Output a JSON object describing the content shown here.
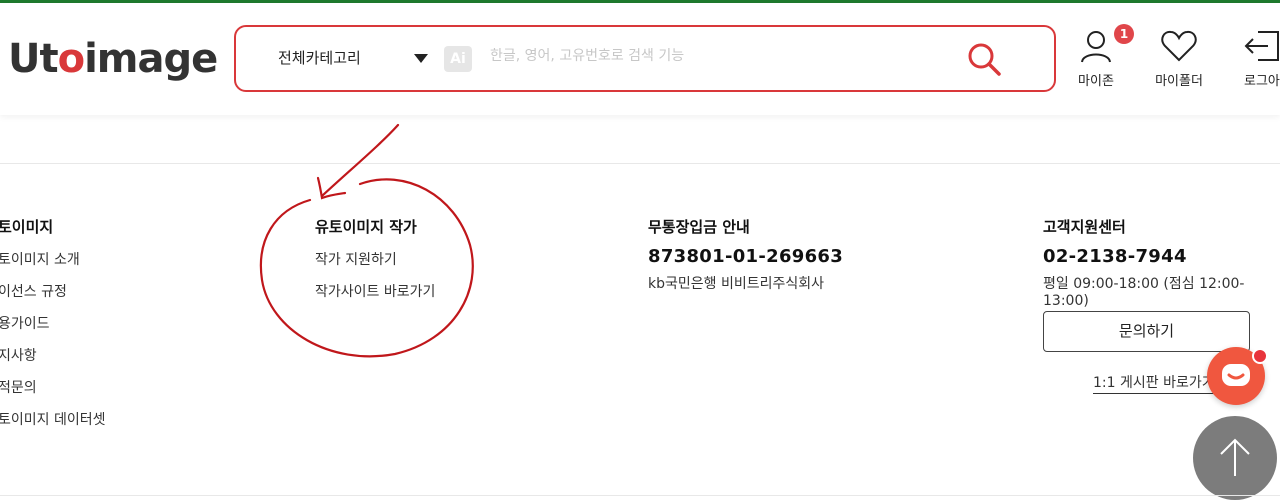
{
  "header": {
    "logo": {
      "pre": "Ut",
      "accent": "o",
      "post": "image"
    },
    "search": {
      "category": "전체카테고리",
      "ai_badge": "Ai",
      "placeholder": "한글, 영어, 고유번호로 검색 기능"
    },
    "nav": {
      "myzone": "마이존",
      "myzone_badge": "1",
      "myfolder": "마이폴더",
      "login": "로그아"
    }
  },
  "footer": {
    "col1": {
      "title": "토이미지",
      "links": [
        "토이미지 소개",
        "이선스 규정",
        "용가이드",
        "지사항",
        "적문의",
        "토이미지 데이터셋"
      ]
    },
    "col2": {
      "title": "유토이미지 작가",
      "links": [
        "작가 지원하기",
        "작가사이트 바로가기"
      ]
    },
    "col3": {
      "title": "무통장입금 안내",
      "account": "873801-01-269663",
      "bank": "kb국민은행 비비트리주식회사"
    },
    "col4": {
      "title": "고객지원센터",
      "phone": "02-2138-7944",
      "hours": "평일 09:00-18:00 (점심 12:00-13:00)",
      "inquiry_button": "문의하기",
      "board_link": "1:1 게시판 바로가기"
    }
  },
  "colors": {
    "accent": "#d9383a",
    "top_line": "#1f7a2e",
    "annotation": "#c0171b",
    "chat": "#f0573f",
    "top_button": "#7c7c7c"
  },
  "icons": [
    "search-icon",
    "caret-down-icon",
    "user-icon",
    "heart-icon",
    "logout-icon",
    "chat-icon",
    "arrow-up-icon"
  ]
}
